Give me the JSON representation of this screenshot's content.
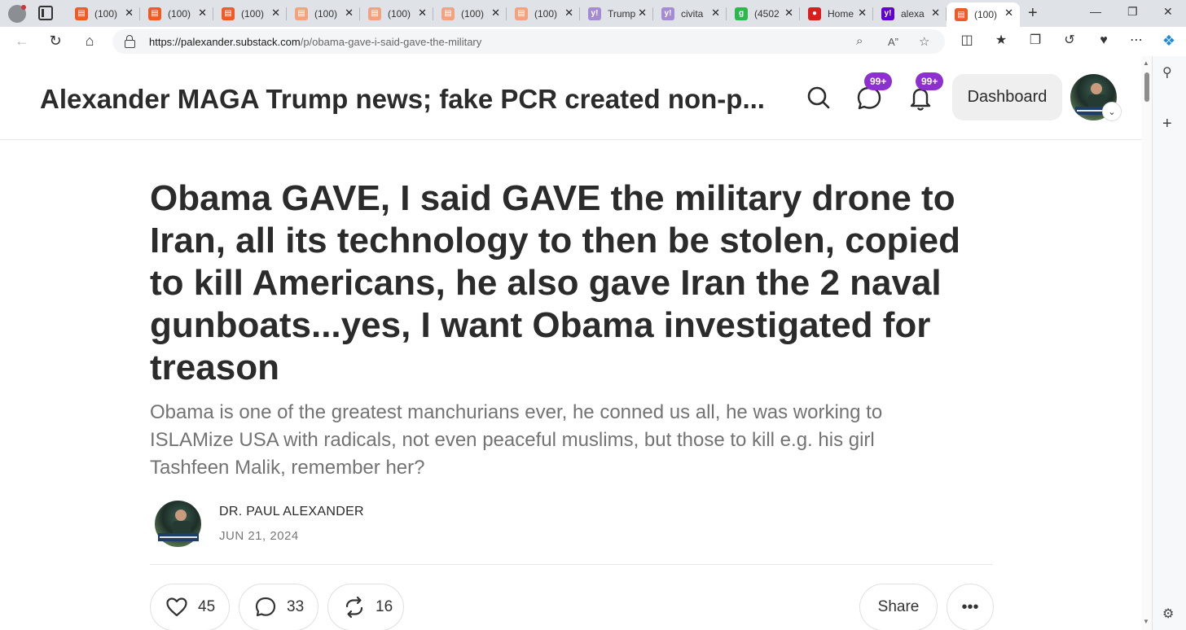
{
  "browser": {
    "tabs": [
      {
        "title": "(100)",
        "icon": "substack-icon",
        "color": "#f15a22"
      },
      {
        "title": "(100)",
        "icon": "substack-icon",
        "color": "#f15a22"
      },
      {
        "title": "(100)",
        "icon": "substack-icon",
        "color": "#f15a22"
      },
      {
        "title": "(100)",
        "icon": "substack-icon",
        "color": "#f4a27e"
      },
      {
        "title": "(100)",
        "icon": "substack-icon",
        "color": "#f4a27e"
      },
      {
        "title": "(100)",
        "icon": "substack-icon",
        "color": "#f4a27e"
      },
      {
        "title": "(100)",
        "icon": "substack-icon",
        "color": "#f4a27e"
      },
      {
        "title": "Trump",
        "icon": "yahoo-icon",
        "color": "#a58bd4"
      },
      {
        "title": "civita",
        "icon": "yahoo-icon",
        "color": "#a58bd4"
      },
      {
        "title": "(4502",
        "icon": "g-icon",
        "color": "#2db84d"
      },
      {
        "title": "Home",
        "icon": "red-circle-icon",
        "color": "#d81e1e"
      },
      {
        "title": "alexa",
        "icon": "yahoo-icon",
        "color": "#5f01d1"
      },
      {
        "title": "(100)",
        "icon": "substack-icon",
        "color": "#f15a22"
      }
    ],
    "url_host": "https://palexander.substack.com",
    "url_path": "/p/obama-gave-i-said-gave-the-military"
  },
  "site": {
    "title": "Alexander MAGA Trump news; fake PCR created non-p...",
    "chat_badge": "99+",
    "notif_badge": "99+",
    "dashboard_label": "Dashboard"
  },
  "post": {
    "title": "Obama GAVE, I said GAVE the military drone to Iran, all its technology to then be stolen, copied to kill Americans, he also gave Iran the 2 naval gunboats...yes, I want Obama investigated for treason",
    "subtitle": "Obama is one of the greatest manchurians ever, he conned us all, he was working to ISLAMize USA with radicals, not even peaceful muslims, but those to kill e.g. his girl Tashfeen Malik, remember her?",
    "author": "DR. PAUL ALEXANDER",
    "date": "JUN 21, 2024"
  },
  "actions": {
    "likes": "45",
    "comments": "33",
    "restacks": "16",
    "share_label": "Share"
  }
}
